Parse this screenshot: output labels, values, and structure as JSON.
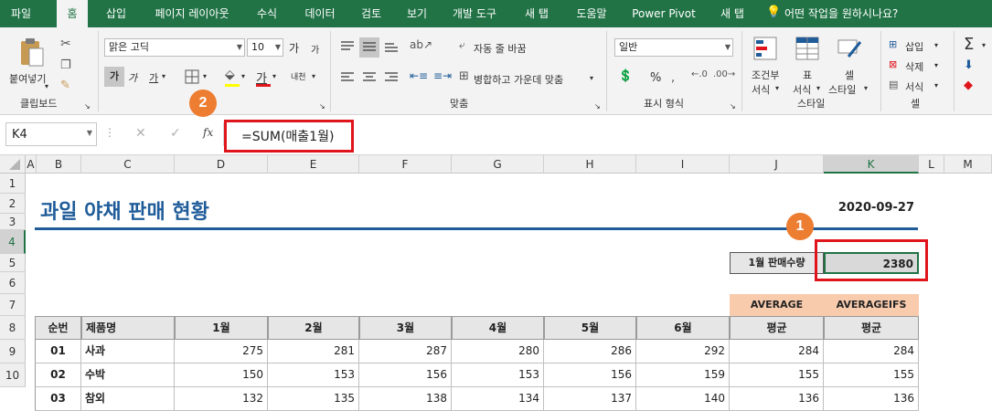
{
  "tabs": [
    "파일",
    "홈",
    "삽입",
    "페이지 레이아웃",
    "수식",
    "데이터",
    "검토",
    "보기",
    "개발 도구",
    "새 탭",
    "도움말",
    "Power Pivot",
    "새 탭",
    "어떤 작업을 원하시나요?"
  ],
  "ribbon": {
    "clipboard": {
      "paste_label": "붙여넣기",
      "group_label": "클립보드"
    },
    "font": {
      "name": "맑은 고딕",
      "size": "10",
      "bold": "가",
      "italic": "가",
      "underline": "가",
      "font_color_glyph": "가",
      "phonetic": "내천",
      "grow": "가",
      "shrink": "가"
    },
    "alignment": {
      "wrap_label": "자동 줄 바꿈",
      "merge_label": "병합하고 가운데 맞춤",
      "group_label": "맞춤"
    },
    "number": {
      "format": "일반",
      "percent": "%",
      "group_label": "표시 형식"
    },
    "styles": {
      "conditional_line1": "조건부",
      "conditional_line2": "서식",
      "table_line1": "표",
      "table_line2": "서식",
      "cell_line1": "셀",
      "cell_line2": "스타일",
      "group_label": "스타일"
    },
    "cells": {
      "insert": "삽입",
      "delete": "삭제",
      "format": "서식",
      "group_label": "셀"
    },
    "editing": {
      "sum": "Σ"
    }
  },
  "formula_bar": {
    "name_box": "K4",
    "fx": "fx",
    "formula": "=SUM(매출1월)"
  },
  "columns": [
    "A",
    "B",
    "C",
    "D",
    "E",
    "F",
    "G",
    "H",
    "I",
    "J",
    "K",
    "L",
    "M"
  ],
  "rows": [
    "1",
    "2",
    "3",
    "4",
    "5",
    "6",
    "7",
    "8",
    "9",
    "10"
  ],
  "sheet": {
    "title": "과일 야채 판매 현황",
    "date": "2020-09-27",
    "summary_label": "1월 판매수량",
    "summary_value": "2380",
    "func_headers": [
      "AVERAGE",
      "AVERAGEIFS"
    ],
    "table_headers": [
      "순번",
      "제품명",
      "1월",
      "2월",
      "3월",
      "4월",
      "5월",
      "6월",
      "평균",
      "평균"
    ],
    "table_rows": [
      [
        "01",
        "사과",
        "275",
        "281",
        "287",
        "280",
        "286",
        "292",
        "284",
        "284"
      ],
      [
        "02",
        "수박",
        "150",
        "153",
        "156",
        "153",
        "156",
        "159",
        "155",
        "155"
      ],
      [
        "03",
        "참외",
        "132",
        "135",
        "138",
        "134",
        "137",
        "140",
        "136",
        "136"
      ]
    ]
  },
  "badges": [
    "1",
    "2"
  ],
  "colors": {
    "excel_green": "#217346",
    "highlight_red": "#e0151b",
    "badge_orange": "#ed7d31",
    "title_blue": "#1f5c99",
    "func_header_bg": "#f8cbad"
  }
}
